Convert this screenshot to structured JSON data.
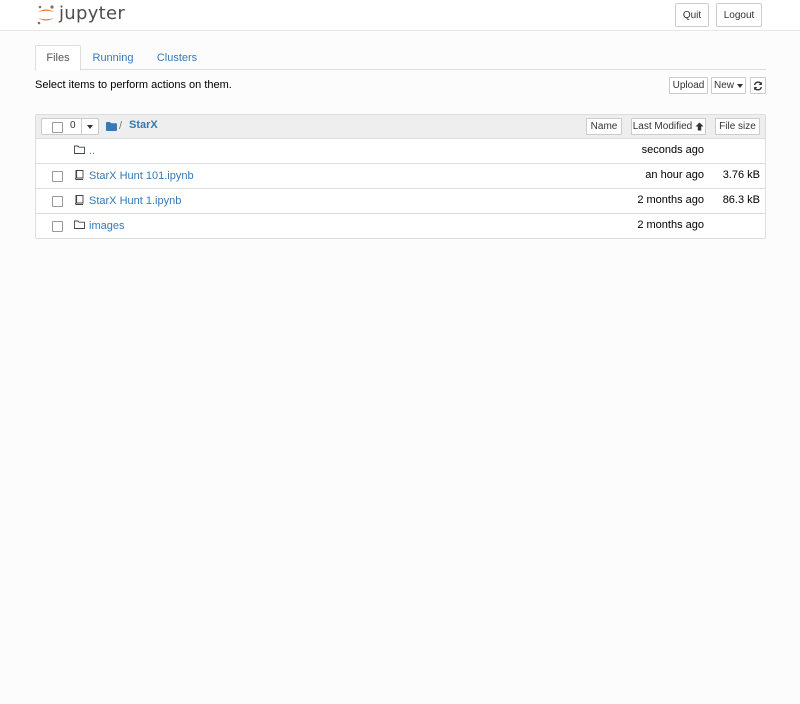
{
  "header": {
    "logo_text": "jupyter",
    "quit_label": "Quit",
    "logout_label": "Logout"
  },
  "tabs": [
    {
      "label": "Files",
      "active": true
    },
    {
      "label": "Running",
      "active": false
    },
    {
      "label": "Clusters",
      "active": false
    }
  ],
  "toolbar": {
    "hint": "Select items to perform actions on them.",
    "upload_label": "Upload",
    "new_label": "New",
    "refresh_icon": "refresh-icon"
  },
  "list": {
    "selected_count": "0",
    "breadcrumb_sep": "/",
    "current_dir": "StarX",
    "sort_name": "Name",
    "sort_modified": "Last Modified",
    "sort_size": "File size",
    "rows": [
      {
        "type": "folder",
        "name": "..",
        "modified": "seconds ago",
        "size": ""
      },
      {
        "type": "notebook",
        "name": "StarX Hunt 101.ipynb",
        "modified": "an hour ago",
        "size": "3.76 kB"
      },
      {
        "type": "notebook",
        "name": "StarX Hunt 1.ipynb",
        "modified": "2 months ago",
        "size": "86.3 kB"
      },
      {
        "type": "folder",
        "name": "images",
        "modified": "2 months ago",
        "size": ""
      }
    ]
  },
  "colors": {
    "link": "#337ab7",
    "logo_orange": "#f37726",
    "header_bg": "#eeeeef"
  }
}
